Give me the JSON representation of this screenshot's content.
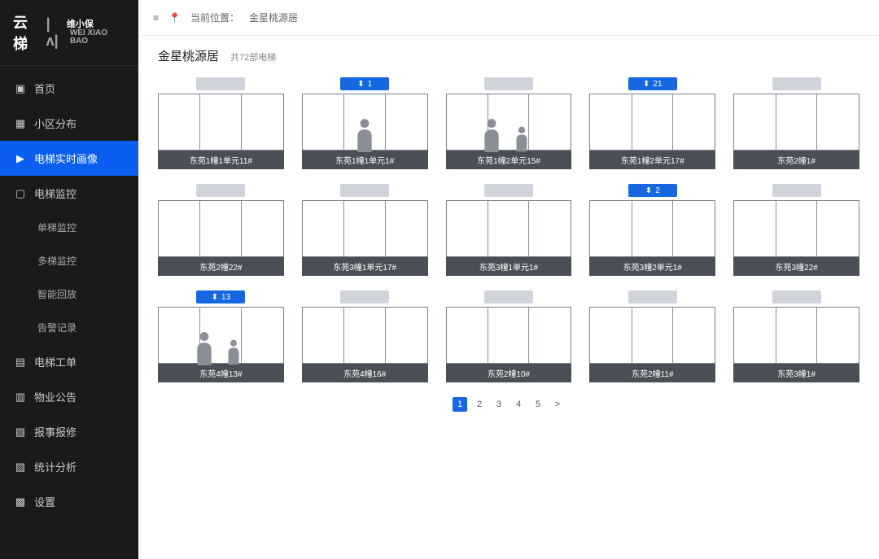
{
  "logo": {
    "main": "云梯",
    "brand": "维小保",
    "brand_en": "WEI XIAO BAO"
  },
  "breadcrumb": {
    "label": "当前位置：",
    "value": "金星桃源居"
  },
  "nav": [
    {
      "icon": "home",
      "label": "首页"
    },
    {
      "icon": "grid",
      "label": "小区分布"
    },
    {
      "icon": "camera",
      "label": "电梯实时画像",
      "active": true
    },
    {
      "icon": "monitor",
      "label": "电梯监控",
      "expanded": true,
      "children": [
        {
          "label": "单梯监控"
        },
        {
          "label": "多梯监控"
        },
        {
          "label": "智能回放"
        },
        {
          "label": "告警记录"
        }
      ]
    },
    {
      "icon": "ticket",
      "label": "电梯工单"
    },
    {
      "icon": "notice",
      "label": "物业公告"
    },
    {
      "icon": "repair",
      "label": "报事报修"
    },
    {
      "icon": "stats",
      "label": "统计分析"
    },
    {
      "icon": "settings",
      "label": "设置"
    }
  ],
  "page": {
    "title": "金星桃源居",
    "subtitle": "共72部电梯"
  },
  "elevators": [
    {
      "label": "东苑1幢1单元11#",
      "badge_on": false,
      "badge_text": "",
      "occupied": false
    },
    {
      "label": "东苑1幢1单元1#",
      "badge_on": true,
      "badge_text": "1",
      "occupied": true
    },
    {
      "label": "东苑1幢2单元15#",
      "badge_on": false,
      "badge_text": "",
      "occupied": true,
      "two": true
    },
    {
      "label": "东苑1幢2单元17#",
      "badge_on": true,
      "badge_text": "21",
      "occupied": false
    },
    {
      "label": "东苑2幢1#",
      "badge_on": false,
      "badge_text": "",
      "occupied": false
    },
    {
      "label": "东苑2幢22#",
      "badge_on": false,
      "badge_text": "",
      "occupied": false
    },
    {
      "label": "东苑3幢1单元17#",
      "badge_on": false,
      "badge_text": "",
      "occupied": false
    },
    {
      "label": "东苑3幢1单元1#",
      "badge_on": false,
      "badge_text": "",
      "occupied": false
    },
    {
      "label": "东苑3幢2单元1#",
      "badge_on": true,
      "badge_text": "2",
      "occupied": false
    },
    {
      "label": "东苑3幢22#",
      "badge_on": false,
      "badge_text": "",
      "occupied": false
    },
    {
      "label": "东苑4幢13#",
      "badge_on": true,
      "badge_text": "13",
      "occupied": true,
      "two": true
    },
    {
      "label": "东苑4幢16#",
      "badge_on": false,
      "badge_text": "",
      "occupied": false
    },
    {
      "label": "东苑2幢10#",
      "badge_on": false,
      "badge_text": "",
      "occupied": false
    },
    {
      "label": "东苑2幢11#",
      "badge_on": false,
      "badge_text": "",
      "occupied": false
    },
    {
      "label": "东苑3幢1#",
      "badge_on": false,
      "badge_text": "",
      "occupied": false
    }
  ],
  "pagination": {
    "pages": [
      "1",
      "2",
      "3",
      "4",
      "5"
    ],
    "current": 0
  },
  "colors": {
    "accent": "#1668e0",
    "sidebar": "#1a1a1a"
  }
}
